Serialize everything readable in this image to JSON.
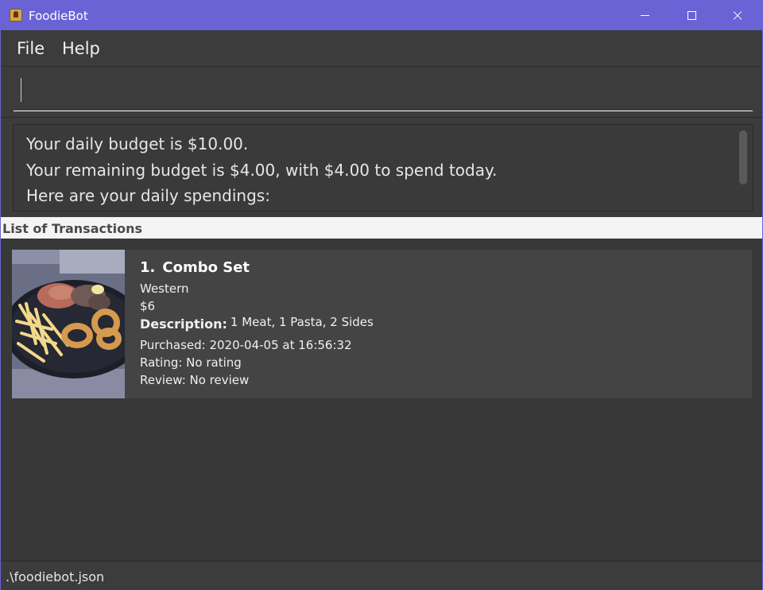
{
  "window": {
    "title": "FoodieBot",
    "accent_color": "#6a63d6"
  },
  "menu": {
    "items": [
      "File",
      "Help"
    ]
  },
  "command": {
    "value": "",
    "placeholder": ""
  },
  "result": {
    "lines": [
      "Your daily budget is $10.00.",
      "Your remaining budget is $4.00, with $4.00 to spend today.",
      "Here are your daily spendings:"
    ]
  },
  "list": {
    "header": "List of Transactions",
    "items": [
      {
        "index": "1.",
        "name": "Combo Set",
        "category": "Western",
        "price": "$6",
        "description_label": "Description:",
        "description": "1 Meat, 1 Pasta, 2 Sides",
        "purchased": "Purchased: 2020-04-05 at 16:56:32",
        "rating": "Rating: No rating",
        "review": "Review: No review",
        "image": "food-plate-photo"
      }
    ]
  },
  "status": {
    "path": ".\\foodiebot.json"
  }
}
